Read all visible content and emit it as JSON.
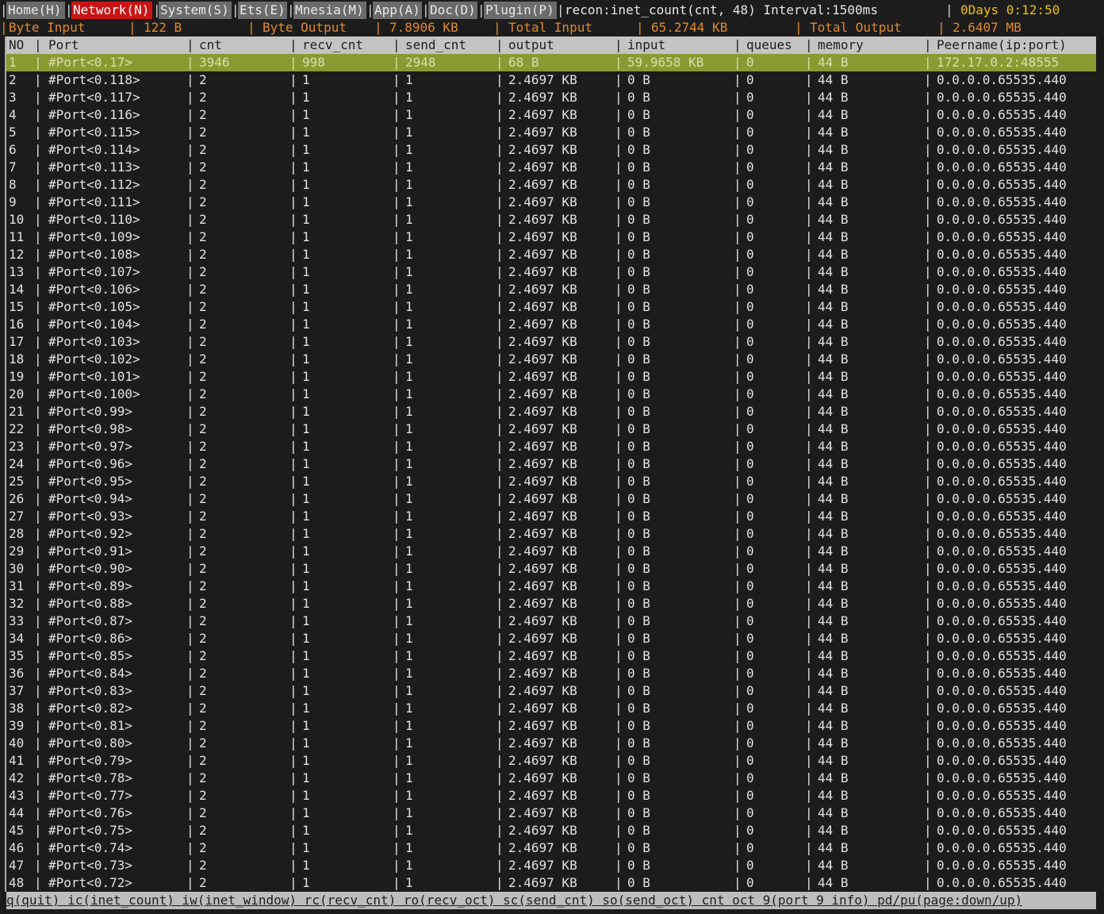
{
  "tabs": [
    {
      "label": "Home(H)",
      "active": false
    },
    {
      "label": "Network(N)",
      "active": true
    },
    {
      "label": "System(S)",
      "active": false
    },
    {
      "label": "Ets(E)",
      "active": false
    },
    {
      "label": "Mnesia(M)",
      "active": false
    },
    {
      "label": "App(A)",
      "active": false
    },
    {
      "label": "Doc(D)",
      "active": false
    },
    {
      "label": "Plugin(P)",
      "active": false
    }
  ],
  "status": {
    "title": "recon:inet_count(cnt, 48) Interval:1500ms",
    "uptime": "0Days 0:12:50"
  },
  "summary": {
    "byte_input_label": "Byte Input",
    "byte_input_value": "122 B",
    "byte_output_label": "Byte Output",
    "byte_output_value": "7.8906 KB",
    "total_input_label": "Total Input",
    "total_input_value": "65.2744 KB",
    "total_output_label": "Total Output",
    "total_output_value": "2.6407 MB"
  },
  "table": {
    "columns": [
      "NO",
      "Port",
      "cnt",
      "recv_cnt",
      "send_cnt",
      "output",
      "input",
      "queues",
      "memory",
      "Peername(ip:port)"
    ],
    "rows": [
      [
        "1",
        "#Port<0.17>",
        "3946",
        "998",
        "2948",
        "68 B",
        "59.9658 KB",
        "0",
        "44 B",
        "172.17.0.2:48555"
      ],
      [
        "2",
        "#Port<0.118>",
        "2",
        "1",
        "1",
        "2.4697 KB",
        "0 B",
        "0",
        "44 B",
        "0.0.0.0.65535.440"
      ],
      [
        "3",
        "#Port<0.117>",
        "2",
        "1",
        "1",
        "2.4697 KB",
        "0 B",
        "0",
        "44 B",
        "0.0.0.0.65535.440"
      ],
      [
        "4",
        "#Port<0.116>",
        "2",
        "1",
        "1",
        "2.4697 KB",
        "0 B",
        "0",
        "44 B",
        "0.0.0.0.65535.440"
      ],
      [
        "5",
        "#Port<0.115>",
        "2",
        "1",
        "1",
        "2.4697 KB",
        "0 B",
        "0",
        "44 B",
        "0.0.0.0.65535.440"
      ],
      [
        "6",
        "#Port<0.114>",
        "2",
        "1",
        "1",
        "2.4697 KB",
        "0 B",
        "0",
        "44 B",
        "0.0.0.0.65535.440"
      ],
      [
        "7",
        "#Port<0.113>",
        "2",
        "1",
        "1",
        "2.4697 KB",
        "0 B",
        "0",
        "44 B",
        "0.0.0.0.65535.440"
      ],
      [
        "8",
        "#Port<0.112>",
        "2",
        "1",
        "1",
        "2.4697 KB",
        "0 B",
        "0",
        "44 B",
        "0.0.0.0.65535.440"
      ],
      [
        "9",
        "#Port<0.111>",
        "2",
        "1",
        "1",
        "2.4697 KB",
        "0 B",
        "0",
        "44 B",
        "0.0.0.0.65535.440"
      ],
      [
        "10",
        "#Port<0.110>",
        "2",
        "1",
        "1",
        "2.4697 KB",
        "0 B",
        "0",
        "44 B",
        "0.0.0.0.65535.440"
      ],
      [
        "11",
        "#Port<0.109>",
        "2",
        "1",
        "1",
        "2.4697 KB",
        "0 B",
        "0",
        "44 B",
        "0.0.0.0.65535.440"
      ],
      [
        "12",
        "#Port<0.108>",
        "2",
        "1",
        "1",
        "2.4697 KB",
        "0 B",
        "0",
        "44 B",
        "0.0.0.0.65535.440"
      ],
      [
        "13",
        "#Port<0.107>",
        "2",
        "1",
        "1",
        "2.4697 KB",
        "0 B",
        "0",
        "44 B",
        "0.0.0.0.65535.440"
      ],
      [
        "14",
        "#Port<0.106>",
        "2",
        "1",
        "1",
        "2.4697 KB",
        "0 B",
        "0",
        "44 B",
        "0.0.0.0.65535.440"
      ],
      [
        "15",
        "#Port<0.105>",
        "2",
        "1",
        "1",
        "2.4697 KB",
        "0 B",
        "0",
        "44 B",
        "0.0.0.0.65535.440"
      ],
      [
        "16",
        "#Port<0.104>",
        "2",
        "1",
        "1",
        "2.4697 KB",
        "0 B",
        "0",
        "44 B",
        "0.0.0.0.65535.440"
      ],
      [
        "17",
        "#Port<0.103>",
        "2",
        "1",
        "1",
        "2.4697 KB",
        "0 B",
        "0",
        "44 B",
        "0.0.0.0.65535.440"
      ],
      [
        "18",
        "#Port<0.102>",
        "2",
        "1",
        "1",
        "2.4697 KB",
        "0 B",
        "0",
        "44 B",
        "0.0.0.0.65535.440"
      ],
      [
        "19",
        "#Port<0.101>",
        "2",
        "1",
        "1",
        "2.4697 KB",
        "0 B",
        "0",
        "44 B",
        "0.0.0.0.65535.440"
      ],
      [
        "20",
        "#Port<0.100>",
        "2",
        "1",
        "1",
        "2.4697 KB",
        "0 B",
        "0",
        "44 B",
        "0.0.0.0.65535.440"
      ],
      [
        "21",
        "#Port<0.99>",
        "2",
        "1",
        "1",
        "2.4697 KB",
        "0 B",
        "0",
        "44 B",
        "0.0.0.0.65535.440"
      ],
      [
        "22",
        "#Port<0.98>",
        "2",
        "1",
        "1",
        "2.4697 KB",
        "0 B",
        "0",
        "44 B",
        "0.0.0.0.65535.440"
      ],
      [
        "23",
        "#Port<0.97>",
        "2",
        "1",
        "1",
        "2.4697 KB",
        "0 B",
        "0",
        "44 B",
        "0.0.0.0.65535.440"
      ],
      [
        "24",
        "#Port<0.96>",
        "2",
        "1",
        "1",
        "2.4697 KB",
        "0 B",
        "0",
        "44 B",
        "0.0.0.0.65535.440"
      ],
      [
        "25",
        "#Port<0.95>",
        "2",
        "1",
        "1",
        "2.4697 KB",
        "0 B",
        "0",
        "44 B",
        "0.0.0.0.65535.440"
      ],
      [
        "26",
        "#Port<0.94>",
        "2",
        "1",
        "1",
        "2.4697 KB",
        "0 B",
        "0",
        "44 B",
        "0.0.0.0.65535.440"
      ],
      [
        "27",
        "#Port<0.93>",
        "2",
        "1",
        "1",
        "2.4697 KB",
        "0 B",
        "0",
        "44 B",
        "0.0.0.0.65535.440"
      ],
      [
        "28",
        "#Port<0.92>",
        "2",
        "1",
        "1",
        "2.4697 KB",
        "0 B",
        "0",
        "44 B",
        "0.0.0.0.65535.440"
      ],
      [
        "29",
        "#Port<0.91>",
        "2",
        "1",
        "1",
        "2.4697 KB",
        "0 B",
        "0",
        "44 B",
        "0.0.0.0.65535.440"
      ],
      [
        "30",
        "#Port<0.90>",
        "2",
        "1",
        "1",
        "2.4697 KB",
        "0 B",
        "0",
        "44 B",
        "0.0.0.0.65535.440"
      ],
      [
        "31",
        "#Port<0.89>",
        "2",
        "1",
        "1",
        "2.4697 KB",
        "0 B",
        "0",
        "44 B",
        "0.0.0.0.65535.440"
      ],
      [
        "32",
        "#Port<0.88>",
        "2",
        "1",
        "1",
        "2.4697 KB",
        "0 B",
        "0",
        "44 B",
        "0.0.0.0.65535.440"
      ],
      [
        "33",
        "#Port<0.87>",
        "2",
        "1",
        "1",
        "2.4697 KB",
        "0 B",
        "0",
        "44 B",
        "0.0.0.0.65535.440"
      ],
      [
        "34",
        "#Port<0.86>",
        "2",
        "1",
        "1",
        "2.4697 KB",
        "0 B",
        "0",
        "44 B",
        "0.0.0.0.65535.440"
      ],
      [
        "35",
        "#Port<0.85>",
        "2",
        "1",
        "1",
        "2.4697 KB",
        "0 B",
        "0",
        "44 B",
        "0.0.0.0.65535.440"
      ],
      [
        "36",
        "#Port<0.84>",
        "2",
        "1",
        "1",
        "2.4697 KB",
        "0 B",
        "0",
        "44 B",
        "0.0.0.0.65535.440"
      ],
      [
        "37",
        "#Port<0.83>",
        "2",
        "1",
        "1",
        "2.4697 KB",
        "0 B",
        "0",
        "44 B",
        "0.0.0.0.65535.440"
      ],
      [
        "38",
        "#Port<0.82>",
        "2",
        "1",
        "1",
        "2.4697 KB",
        "0 B",
        "0",
        "44 B",
        "0.0.0.0.65535.440"
      ],
      [
        "39",
        "#Port<0.81>",
        "2",
        "1",
        "1",
        "2.4697 KB",
        "0 B",
        "0",
        "44 B",
        "0.0.0.0.65535.440"
      ],
      [
        "40",
        "#Port<0.80>",
        "2",
        "1",
        "1",
        "2.4697 KB",
        "0 B",
        "0",
        "44 B",
        "0.0.0.0.65535.440"
      ],
      [
        "41",
        "#Port<0.79>",
        "2",
        "1",
        "1",
        "2.4697 KB",
        "0 B",
        "0",
        "44 B",
        "0.0.0.0.65535.440"
      ],
      [
        "42",
        "#Port<0.78>",
        "2",
        "1",
        "1",
        "2.4697 KB",
        "0 B",
        "0",
        "44 B",
        "0.0.0.0.65535.440"
      ],
      [
        "43",
        "#Port<0.77>",
        "2",
        "1",
        "1",
        "2.4697 KB",
        "0 B",
        "0",
        "44 B",
        "0.0.0.0.65535.440"
      ],
      [
        "44",
        "#Port<0.76>",
        "2",
        "1",
        "1",
        "2.4697 KB",
        "0 B",
        "0",
        "44 B",
        "0.0.0.0.65535.440"
      ],
      [
        "45",
        "#Port<0.75>",
        "2",
        "1",
        "1",
        "2.4697 KB",
        "0 B",
        "0",
        "44 B",
        "0.0.0.0.65535.440"
      ],
      [
        "46",
        "#Port<0.74>",
        "2",
        "1",
        "1",
        "2.4697 KB",
        "0 B",
        "0",
        "44 B",
        "0.0.0.0.65535.440"
      ],
      [
        "47",
        "#Port<0.73>",
        "2",
        "1",
        "1",
        "2.4697 KB",
        "0 B",
        "0",
        "44 B",
        "0.0.0.0.65535.440"
      ],
      [
        "48",
        "#Port<0.72>",
        "2",
        "1",
        "1",
        "2.4697 KB",
        "0 B",
        "0",
        "44 B",
        "0.0.0.0.65535.440"
      ]
    ],
    "selected_row": 0
  },
  "footer": {
    "help": "q(quit) ic(inet_count) iw(inet_window) rc(recv_cnt) ro(recv_oct) sc(send_cnt) so(send_oct) cnt oct 9(port 9 info) pd/pu(page:down/up)"
  },
  "colors": {
    "background": "#1c1c1c",
    "active_tab": "#c81414",
    "tab": "#6b6b6b",
    "summary_text": "#e08a2c",
    "uptime_text": "#f0c000",
    "header_bg": "#c4c4c4",
    "selected_row_bg": "#8a9a32"
  }
}
